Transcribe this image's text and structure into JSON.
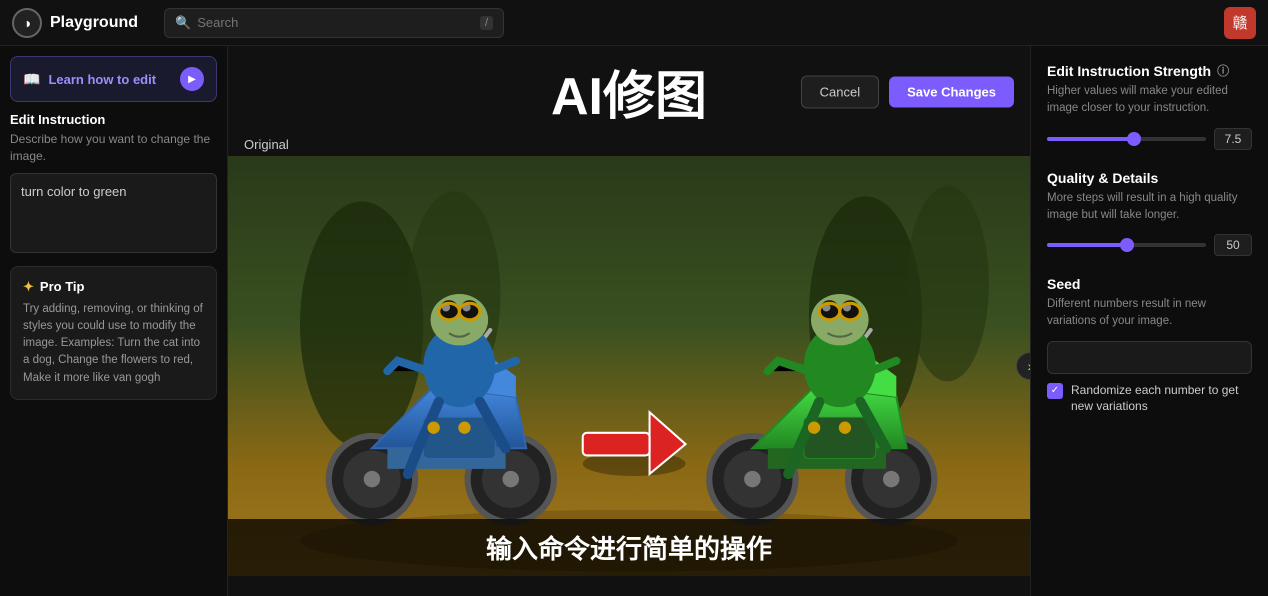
{
  "nav": {
    "logo_text": "Playground",
    "logo_symbol": "◑",
    "search_placeholder": "Search",
    "search_shortcut": "/",
    "avatar_emoji": "赣"
  },
  "left_panel": {
    "learn_btn_label": "Learn how to edit",
    "edit_instruction_title": "Edit Instruction",
    "edit_instruction_desc": "Describe how you want to change the image.",
    "instruction_value": "turn color to green",
    "pro_tip_title": "Pro Tip",
    "pro_tip_text": "Try adding, removing, or thinking of styles you could use to modify the image. Examples: Turn the cat into a dog, Change the flowers to red, Make it more like van gogh"
  },
  "center": {
    "big_title": "AI修图",
    "cancel_label": "Cancel",
    "save_label": "Save Changes",
    "original_label": "Original",
    "subtitle": "输入命令进行简单的操作"
  },
  "right_panel": {
    "strength_title": "Edit Instruction Strength",
    "strength_desc": "Higher values will make your edited image closer to your instruction.",
    "strength_value": "7.5",
    "strength_pct": 55,
    "quality_title": "Quality & Details",
    "quality_desc": "More steps will result in a high quality image but will take longer.",
    "quality_value": "50",
    "quality_pct": 50,
    "seed_title": "Seed",
    "seed_desc": "Different numbers result in new variations of your image.",
    "seed_value": "",
    "randomize_label": "Randomize each number to get new variations"
  }
}
